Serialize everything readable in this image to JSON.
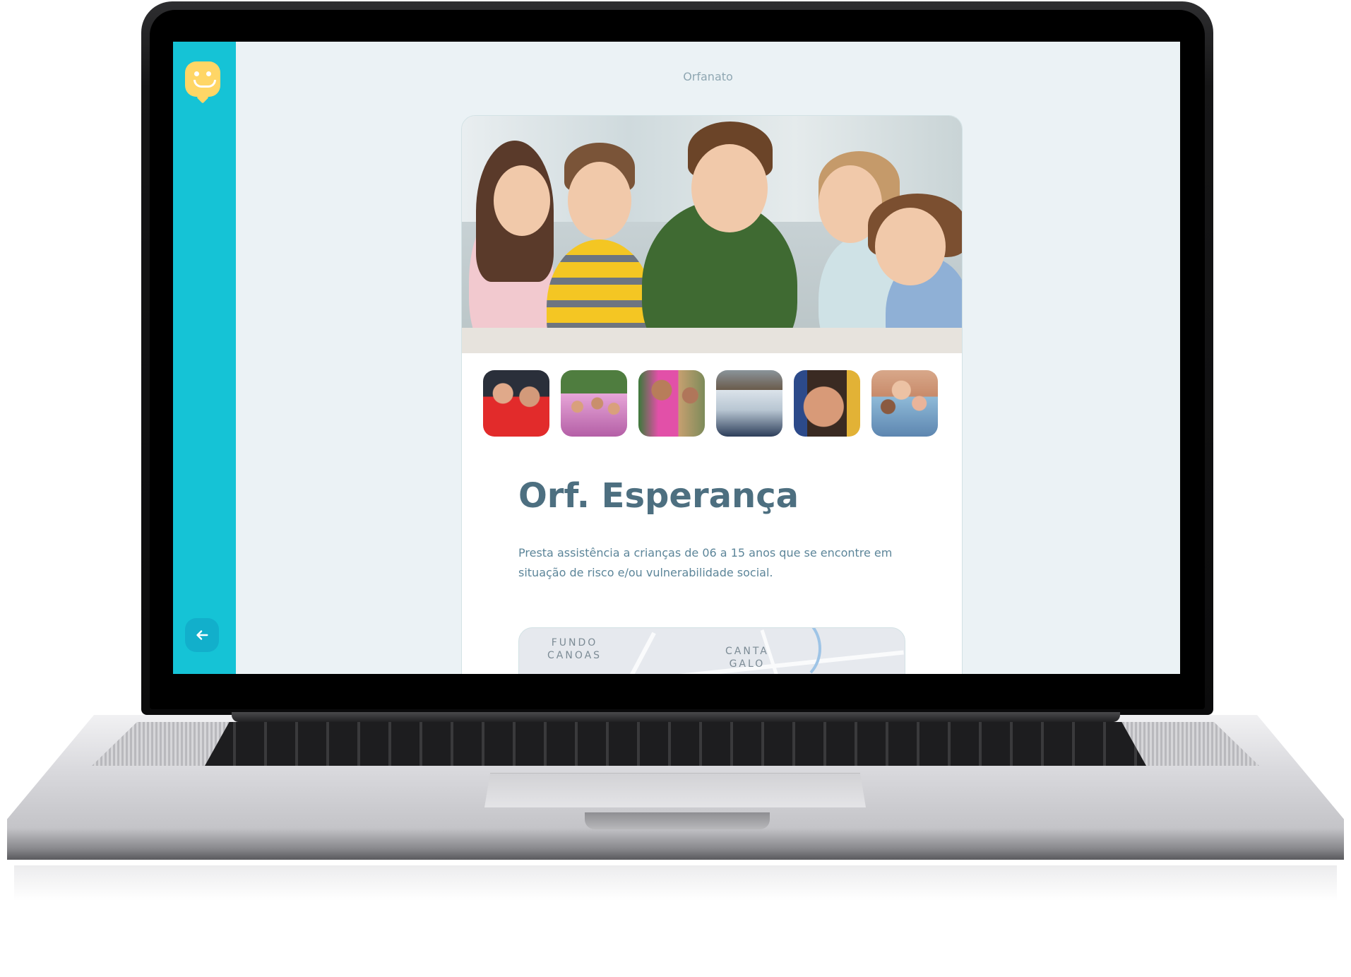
{
  "page": {
    "title": "Orfanato"
  },
  "orphanage": {
    "name": "Orf. Esperança",
    "description": "Presta assistência a crianças de 06 a 15 anos que se encontre em situação de risco e/ou vulnerabilidade social."
  },
  "map": {
    "labels": [
      {
        "line1": "FUNDO",
        "line2": "CANOAS"
      },
      {
        "line1": "CANTA",
        "line2": "GALO"
      }
    ]
  },
  "icons": {
    "logo": "smiley-chat-icon",
    "back": "arrow-left-icon"
  },
  "colors": {
    "sidebar": "#15c3d6",
    "background": "#ebf2f5",
    "title": "#4d6f80",
    "text": "#5c8599",
    "logo": "#ffd666"
  }
}
